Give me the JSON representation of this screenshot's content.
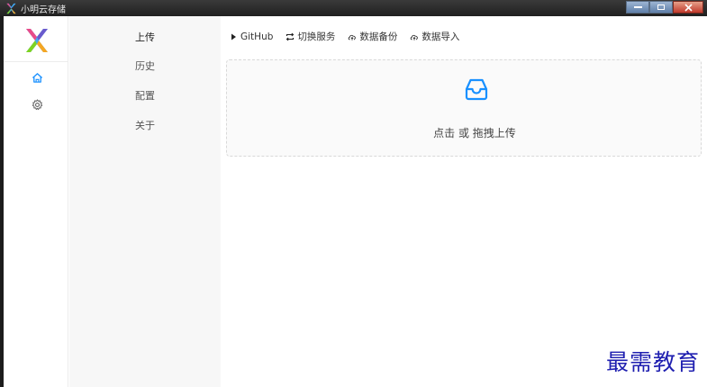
{
  "window": {
    "title": "小明云存储"
  },
  "nav": {
    "rail_icons": [
      "home-icon",
      "gear-icon"
    ],
    "items": [
      {
        "label": "上传",
        "active": true
      },
      {
        "label": "历史",
        "active": false
      },
      {
        "label": "配置",
        "active": false
      },
      {
        "label": "关于",
        "active": false
      }
    ]
  },
  "toolbar": {
    "github": "GitHub",
    "switch_service": "切换服务",
    "backup": "数据备份",
    "import": "数据导入"
  },
  "upload": {
    "text": "点击 或 拖拽上传",
    "icon": "inbox-icon"
  },
  "watermark": "最需教育",
  "colors": {
    "accent": "#1890ff",
    "titlebar": "#2a2a2a",
    "menu_bg": "#f7f7f7"
  }
}
